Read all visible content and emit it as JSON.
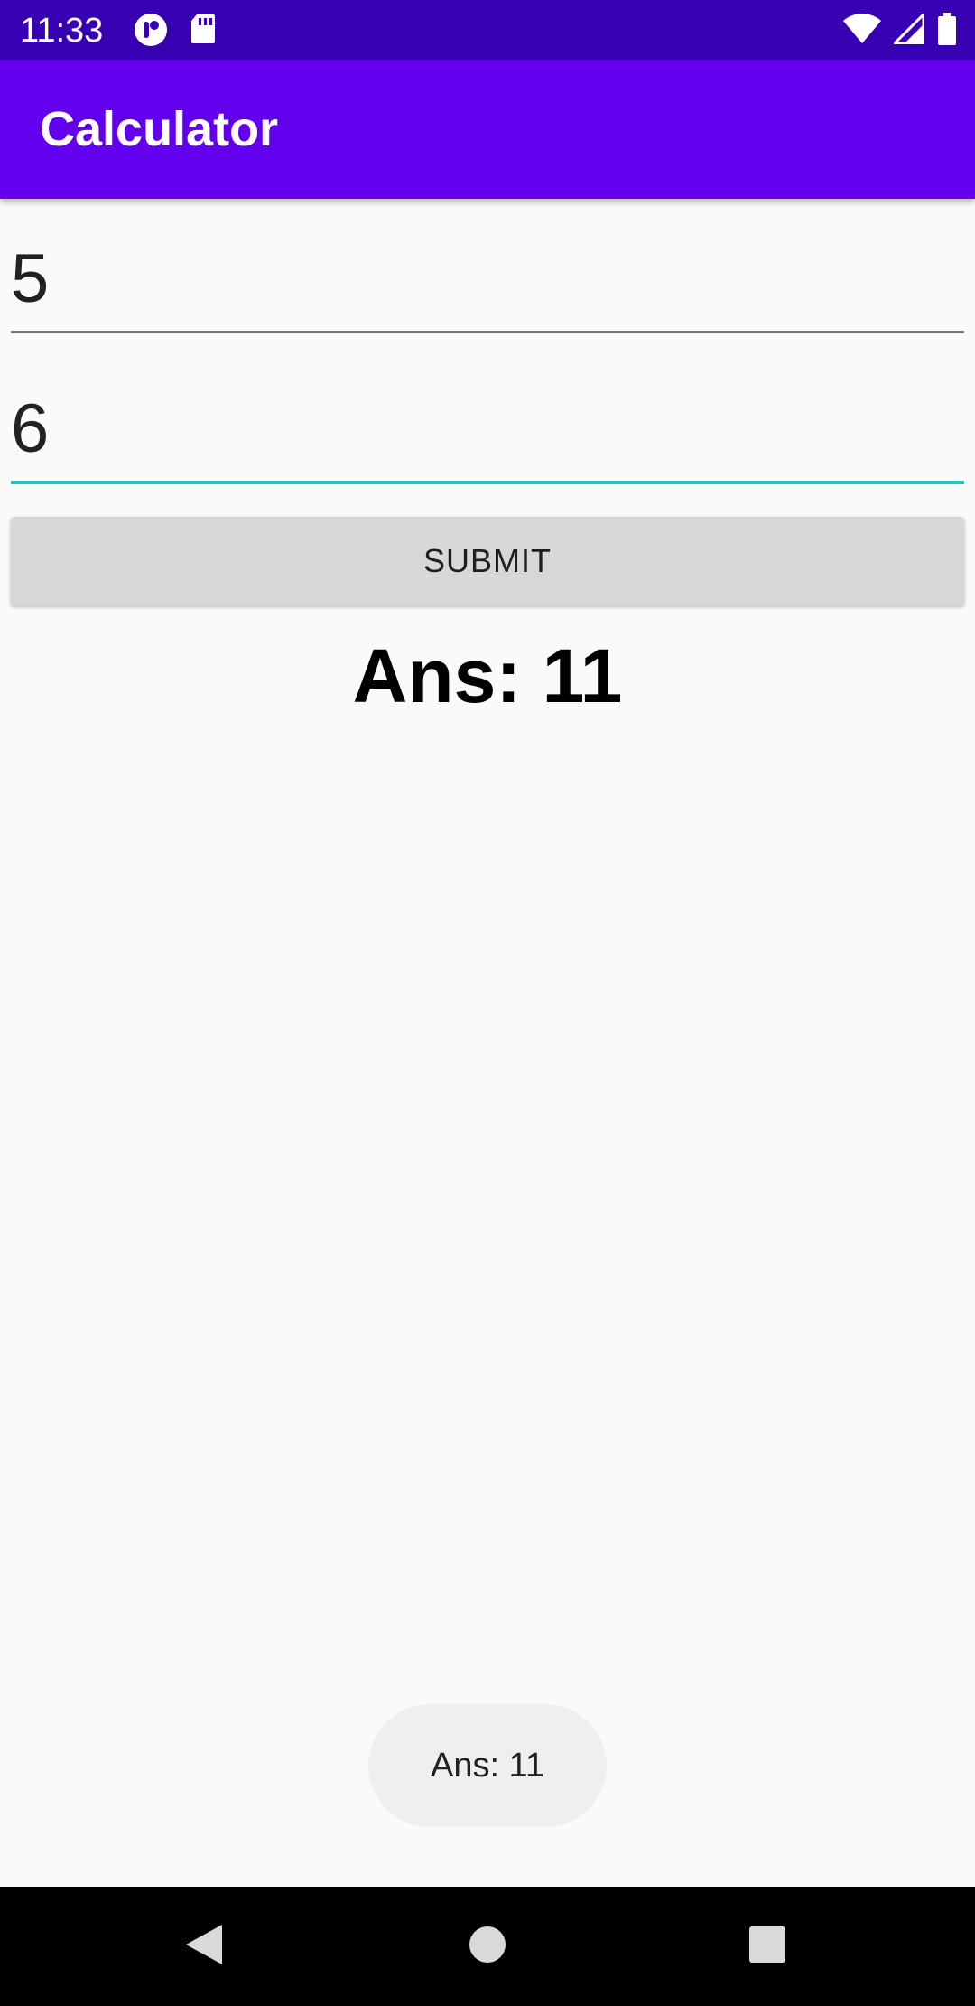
{
  "status_bar": {
    "time": "11:33",
    "icons": [
      "notification-app-icon",
      "sd-card-icon",
      "wifi-icon",
      "signal-icon",
      "battery-icon"
    ]
  },
  "app_bar": {
    "title": "Calculator",
    "color": "#6200ee"
  },
  "form": {
    "first_number": "5",
    "second_number": "6",
    "submit_label": "SUBMIT",
    "focus_color": "#1cc8c0"
  },
  "result": {
    "answer_text": "Ans: 11"
  },
  "toast": {
    "message": "Ans: 11"
  },
  "nav_bar": {
    "buttons": [
      "back-icon",
      "home-icon",
      "recents-icon"
    ]
  }
}
